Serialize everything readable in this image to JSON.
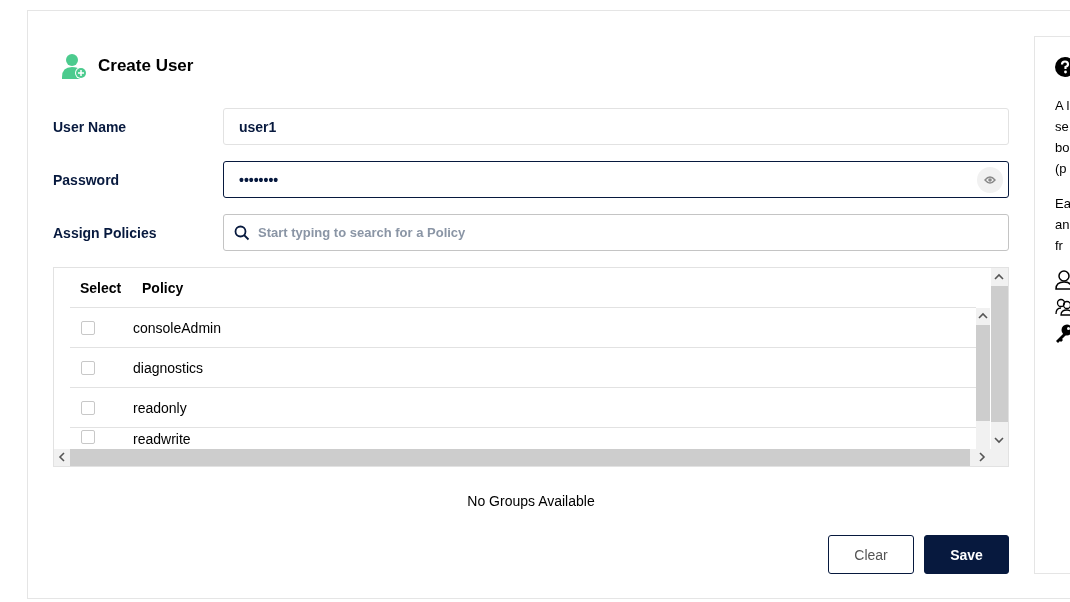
{
  "title": "Create User",
  "fields": [
    {
      "label": "User Name",
      "value": "user1",
      "kind": "text",
      "focused": false
    },
    {
      "label": "Password",
      "value": "••••••••",
      "kind": "password",
      "focused": true
    },
    {
      "label": "Assign Policies",
      "placeholder": "Start typing to search for a Policy",
      "kind": "search",
      "focused": false
    }
  ],
  "table": {
    "columns": [
      "Select",
      "Policy"
    ],
    "rows": [
      {
        "policy": "consoleAdmin",
        "checked": false
      },
      {
        "policy": "diagnostics",
        "checked": false
      },
      {
        "policy": "readonly",
        "checked": false
      },
      {
        "policy": "readwrite",
        "checked": false
      }
    ]
  },
  "groups_message": "No Groups Available",
  "buttons": [
    {
      "label": "Clear",
      "kind": "secondary"
    },
    {
      "label": "Save",
      "kind": "primary"
    }
  ],
  "help": {
    "paragraphs": [
      [
        "A l",
        "se",
        "bo",
        "(p"
      ],
      [
        "Ea",
        "an",
        "fr"
      ]
    ]
  }
}
